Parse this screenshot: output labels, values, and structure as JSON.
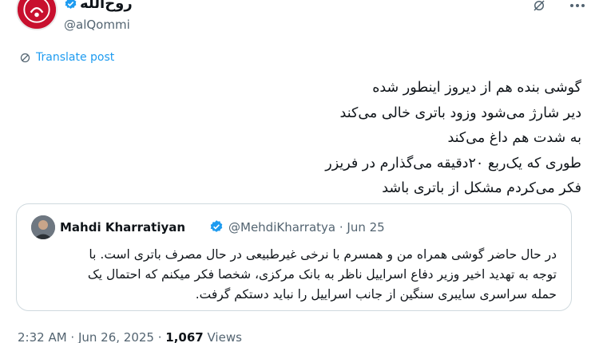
{
  "author": {
    "display_name": "روح‌الله",
    "handle": "@alQommi"
  },
  "translate_label": "Translate post",
  "tweet_lines": [
    "گوشی بنده هم از دیروز اینطور شده",
    "دیر شارژ می‌شود وزود باتری خالی می‌کند",
    "به شدت هم داغ می‌کند",
    "طوری که یک‌ربع ۲۰دقیقه می‌گذارم در فریزر",
    "فکر می‌کردم مشکل از باتری باشد"
  ],
  "quote": {
    "name": "Mahdi Kharratiyan",
    "handle_date": "@MehdiKharratya · Jun 25",
    "lines": [
      "در حال حاضر گوشی همراه من و همسرم با نرخی غیرطبیعی در حال مصرف باتری است. با",
      "توجه به تهدید اخیر وزیر دفاع اسراییل ناظر به بانک مرکزی، شخصا فکر میکنم که احتمال یک",
      "حمله سراسری سایبری سنگین از جانب اسراییل را نباید دستکم گرفت."
    ]
  },
  "meta": {
    "time_date": "2:32 AM · Jun 26, 2025 · ",
    "views_count": "1,067",
    "views_label": " Views"
  },
  "colors": {
    "accent": "#1d9bf0",
    "avatar_red": "#c8102e",
    "secondary_text": "#536471",
    "border": "#cfd9de"
  },
  "icons": [
    "verified-badge-icon",
    "grok-icon",
    "more-options-icon",
    "translate-icon"
  ]
}
